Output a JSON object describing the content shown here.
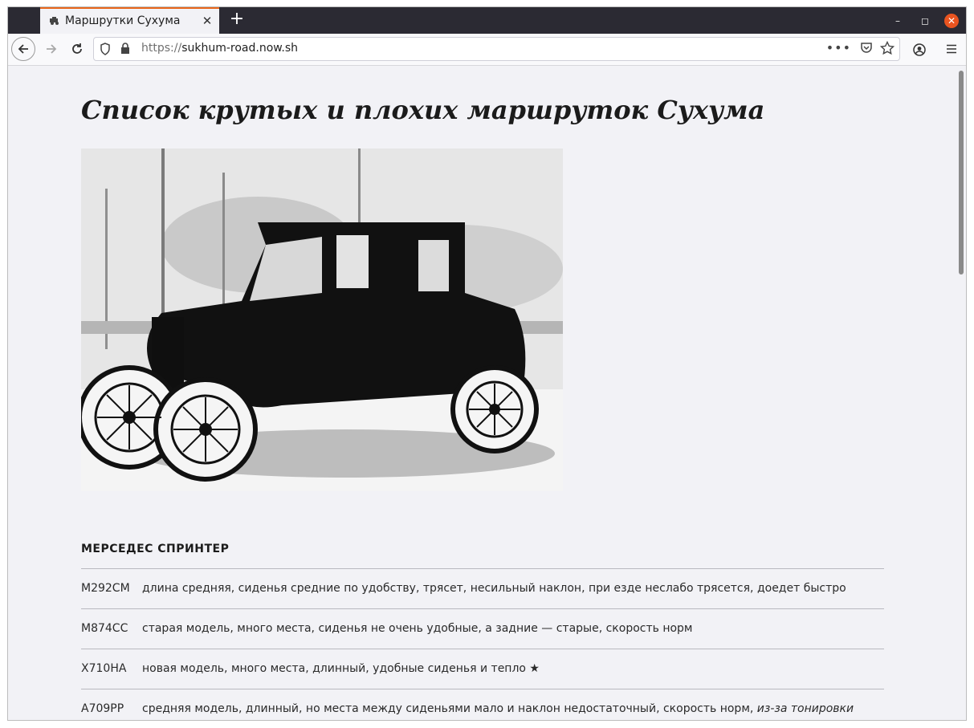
{
  "browser": {
    "tab_title": "Маршрутки Сухума",
    "tab_close": "✕",
    "new_tab": "+",
    "url_scheme": "https://",
    "url_host": "sukhum-road.now.sh",
    "window_controls": {
      "minimize": "–",
      "maximize": "◻",
      "close": "✕"
    }
  },
  "page": {
    "title": "Список крутых и плохих маршруток Сухума",
    "section_title": "МЕРСЕДЕС СПРИНТЕР",
    "rows": [
      {
        "code": "М292СМ",
        "desc": "длина средняя, сиденья средние по удобству, трясет, несильный наклон, при езде неслабо трясется, доедет быстро",
        "note": ""
      },
      {
        "code": "М874СС",
        "desc": "старая модель, много места, сиденья не очень удобные, а задние — старые, скорость норм",
        "note": ""
      },
      {
        "code": "Х710НА",
        "desc": "новая модель, много места, длинный, удобные сиденья и тепло ★",
        "note": ""
      },
      {
        "code": "А709РР",
        "desc": "средняя модель, длинный, но места между сиденьями мало и наклон недостаточный, скорость норм, ",
        "note": "из-за тонировки"
      }
    ]
  },
  "icons": {
    "tab_favicon": "car-icon",
    "back": "arrow-left-icon",
    "forward": "arrow-right-icon",
    "reload": "reload-icon",
    "tracking": "shield-icon",
    "lock": "lock-icon",
    "page_actions": "more-icon",
    "pocket": "pocket-icon",
    "bookmark": "star-icon",
    "account": "account-icon",
    "menu": "hamburger-icon"
  },
  "colors": {
    "tab_accent": "#e8661a",
    "close_button": "#e95420",
    "page_background": "#f2f2f6"
  }
}
